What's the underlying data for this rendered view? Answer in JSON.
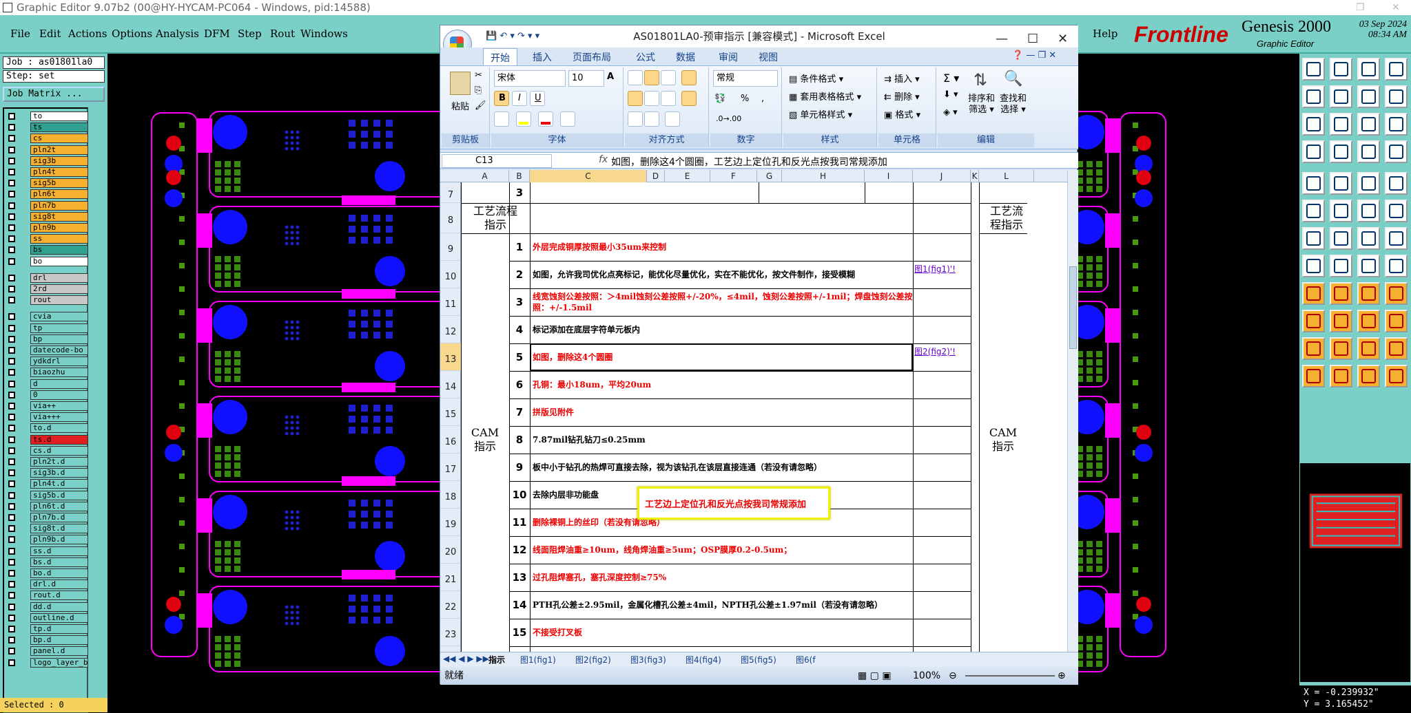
{
  "ge": {
    "title": "Graphic Editor 9.07b2 (00@HY-HYCAM-PC064 - Windows, pid:14588)",
    "menus": [
      "File",
      "Edit",
      "Actions",
      "Options",
      "Analysis",
      "DFM",
      "Step",
      "Rout",
      "Windows"
    ],
    "help": "Help",
    "brand": "Frontline",
    "product": "Genesis 2000",
    "subtitle": "Graphic Editor",
    "date": "03 Sep 2024",
    "time": "08:34 AM",
    "job": "Job : as01801la0",
    "step": "Step: set",
    "job_matrix": "Job Matrix ...",
    "selected": "Selected : 0",
    "coord_x": "X = -0.239932\"",
    "coord_y": "Y = 3.165452\"",
    "layers": [
      {
        "name": "to",
        "color": "#ffffff"
      },
      {
        "name": "ts",
        "color": "#30a090"
      },
      {
        "name": "cs",
        "color": "#f5b030"
      },
      {
        "name": "pln2t",
        "color": "#f5b030"
      },
      {
        "name": "sig3b",
        "color": "#f5b030"
      },
      {
        "name": "pln4t",
        "color": "#f5b030"
      },
      {
        "name": "sig5b",
        "color": "#f5b030"
      },
      {
        "name": "pln6t",
        "color": "#f5b030"
      },
      {
        "name": "pln7b",
        "color": "#f5b030"
      },
      {
        "name": "sig8t",
        "color": "#f5b030"
      },
      {
        "name": "pln9b",
        "color": "#f5b030"
      },
      {
        "name": "ss",
        "color": "#f5b030"
      },
      {
        "name": "bs",
        "color": "#30a090"
      },
      {
        "name": "bo",
        "color": "#ffffff"
      },
      {
        "name": "drl",
        "color": "#c8c8c8"
      },
      {
        "name": "2rd",
        "color": "#c8c8c8"
      },
      {
        "name": "rout",
        "color": "#c8c8c8"
      },
      {
        "name": "cvia",
        "color": "#7ad0c6"
      },
      {
        "name": "tp",
        "color": "#7ad0c6"
      },
      {
        "name": "bp",
        "color": "#7ad0c6"
      },
      {
        "name": "datecode-bo",
        "color": "#7ad0c6"
      },
      {
        "name": "ydkdrl",
        "color": "#7ad0c6"
      },
      {
        "name": "biaozhu",
        "color": "#7ad0c6"
      },
      {
        "name": "d",
        "color": "#7ad0c6"
      },
      {
        "name": "0",
        "color": "#7ad0c6"
      },
      {
        "name": "via++",
        "color": "#7ad0c6"
      },
      {
        "name": "via+++",
        "color": "#7ad0c6"
      },
      {
        "name": "to.d",
        "color": "#7ad0c6"
      },
      {
        "name": "ts.d",
        "color": "#e02020"
      },
      {
        "name": "cs.d",
        "color": "#7ad0c6"
      },
      {
        "name": "pln2t.d",
        "color": "#7ad0c6"
      },
      {
        "name": "sig3b.d",
        "color": "#7ad0c6"
      },
      {
        "name": "pln4t.d",
        "color": "#7ad0c6"
      },
      {
        "name": "sig5b.d",
        "color": "#7ad0c6"
      },
      {
        "name": "pln6t.d",
        "color": "#7ad0c6"
      },
      {
        "name": "pln7b.d",
        "color": "#7ad0c6"
      },
      {
        "name": "sig8t.d",
        "color": "#7ad0c6"
      },
      {
        "name": "pln9b.d",
        "color": "#7ad0c6"
      },
      {
        "name": "ss.d",
        "color": "#7ad0c6"
      },
      {
        "name": "bs.d",
        "color": "#7ad0c6"
      },
      {
        "name": "bo.d",
        "color": "#7ad0c6"
      },
      {
        "name": "drl.d",
        "color": "#7ad0c6"
      },
      {
        "name": "rout.d",
        "color": "#7ad0c6"
      },
      {
        "name": "dd.d",
        "color": "#7ad0c6"
      },
      {
        "name": "outline.d",
        "color": "#7ad0c6"
      },
      {
        "name": "tp.d",
        "color": "#7ad0c6"
      },
      {
        "name": "bp.d",
        "color": "#7ad0c6"
      },
      {
        "name": "panel.d",
        "color": "#7ad0c6"
      },
      {
        "name": "logo_layer_b",
        "color": "#7ad0c6"
      }
    ]
  },
  "excel": {
    "title": "AS01801LA0-预审指示 [兼容模式] - Microsoft Excel",
    "tabs": [
      "开始",
      "插入",
      "页面布局",
      "公式",
      "数据",
      "审阅",
      "视图"
    ],
    "ribbon": {
      "paste": "粘贴",
      "clipboard": "剪贴板",
      "font_name": "宋体",
      "font_size": "10",
      "font_group": "字体",
      "align_group": "对齐方式",
      "number_format": "常规",
      "number_group": "数字",
      "cond_format": "条件格式",
      "table_format": "套用表格格式",
      "cell_style": "单元格样式",
      "style_group": "样式",
      "insert": "插入",
      "delete": "删除",
      "format": "格式",
      "cells_group": "单元格",
      "sort_filter": "排序和筛选",
      "find_select": "查找和选择",
      "edit_group": "编辑",
      "sort_l1": "排序和",
      "sort_l2": "筛选",
      "find_l1": "查找和",
      "find_l2": "选择"
    },
    "name_box": "C13",
    "fx": "fx",
    "formula": "如图，删除这4个圆圈，工艺边上定位孔和反光点按我司常规添加",
    "columns": [
      "A",
      "B",
      "C",
      "D",
      "E",
      "F",
      "G",
      "H",
      "I",
      "J",
      "K",
      "L"
    ],
    "section_process": "工艺流程指示",
    "section_cam": "CAM指示",
    "row3": "3",
    "rows": [
      {
        "row": "9",
        "num": "1",
        "text": "外层完成铜厚按照最小35um来控制",
        "red": true,
        "link": ""
      },
      {
        "row": "10",
        "num": "2",
        "text": "如图，允许我司优化点亮标记，能优化尽量优化，实在不能优化，按文件制作，接受模糊",
        "red": false,
        "link": "图1(fig1)'!"
      },
      {
        "row": "11",
        "num": "3",
        "text": "线宽蚀刻公差按照：＞4mil蚀刻公差按照+/-20%，≤4mil，蚀刻公差按照+/-1mil；焊盘蚀刻公差按照：+/-1.5mil",
        "red": true,
        "link": ""
      },
      {
        "row": "12",
        "num": "4",
        "text": "标记添加在底层字符单元板内",
        "red": false,
        "link": ""
      },
      {
        "row": "13",
        "num": "5",
        "text": "如图，删除这4个圆圈",
        "red": true,
        "link": "图2(fig2)'!"
      },
      {
        "row": "14",
        "num": "6",
        "text": "孔铜：最小18um，平均20um",
        "red": true,
        "link": ""
      },
      {
        "row": "15",
        "num": "7",
        "text": "拼版见附件",
        "red": true,
        "link": ""
      },
      {
        "row": "16",
        "num": "8",
        "text": "7.87mil钻孔钻刀≤0.25mm",
        "red": false,
        "link": ""
      },
      {
        "row": "17",
        "num": "9",
        "text": "板中小于钻孔的热焊可直接去除，视为该钻孔在该层直接连通（若没有请忽略）",
        "red": false,
        "link": ""
      },
      {
        "row": "18",
        "num": "10",
        "text": "去除内层非功能盘",
        "red": false,
        "link": ""
      },
      {
        "row": "19",
        "num": "11",
        "text": "删除裸铜上的丝印（若没有请忽略）",
        "red": true,
        "link": ""
      },
      {
        "row": "20",
        "num": "12",
        "text": "线面阻焊油重≥10um，线角焊油重≥5um；OSP膜厚0.2-0.5um；",
        "red": true,
        "link": ""
      },
      {
        "row": "21",
        "num": "13",
        "text": "过孔阻焊塞孔，塞孔深度控制≥75%",
        "red": true,
        "link": ""
      },
      {
        "row": "22",
        "num": "14",
        "text": "PTH孔公差±2.95mil，金属化槽孔公差±4mil，NPTH孔公差±1.97mil（若没有请忽略）",
        "red": false,
        "link": ""
      },
      {
        "row": "23",
        "num": "15",
        "text": "不接受打叉板",
        "red": true,
        "link": ""
      }
    ],
    "annotation": "工艺边上定位孔和反光点按我司常规添加",
    "sheet_tabs": [
      "指示",
      "图1(fig1)",
      "图2(fig2)",
      "图3(fig3)",
      "图4(fig4)",
      "图5(fig5)",
      "图6(f"
    ],
    "status": "就绪",
    "zoom": "100%"
  }
}
